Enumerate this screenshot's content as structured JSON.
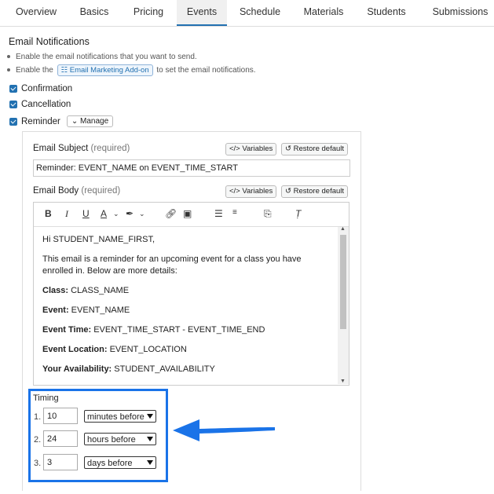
{
  "tabs": [
    "Overview",
    "Basics",
    "Pricing",
    "Events",
    "Schedule",
    "Materials",
    "Students",
    "Submissions"
  ],
  "active_tab": "Events",
  "section_title": "Email Notifications",
  "bullets": {
    "b1": "Enable the email notifications that you want to send.",
    "b2_prefix": "Enable the",
    "b2_button": "Email Marketing Add-on",
    "b2_suffix": "to set the email notifications."
  },
  "checkboxes": {
    "confirmation": "Confirmation",
    "cancellation": "Cancellation",
    "reminder": "Reminder",
    "manage": "Manage"
  },
  "subject": {
    "label": "Email Subject",
    "required": "(required)",
    "variables": "Variables",
    "restore": "Restore default",
    "value": "Reminder: EVENT_NAME on EVENT_TIME_START"
  },
  "body": {
    "label": "Email Body",
    "required": "(required)",
    "variables": "Variables",
    "restore": "Restore default",
    "greeting": "Hi STUDENT_NAME_FIRST,",
    "intro": "This email is a reminder for an upcoming event for a class you have enrolled in. Below are more details:",
    "class_label": "Class:",
    "class_value": " CLASS_NAME",
    "event_label": "Event:",
    "event_value": " EVENT_NAME",
    "time_label": "Event Time:",
    "time_value": " EVENT_TIME_START - EVENT_TIME_END",
    "location_label": "Event Location:",
    "location_value": " EVENT_LOCATION",
    "avail_label": "Your Availability:",
    "avail_value": " STUDENT_AVAILABILITY"
  },
  "timing": {
    "title": "Timing",
    "rows": [
      {
        "num": "1.",
        "value": "10",
        "unit": "minutes before"
      },
      {
        "num": "2.",
        "value": "24",
        "unit": "hours before"
      },
      {
        "num": "3.",
        "value": "3",
        "unit": "days before"
      }
    ]
  },
  "colors": {
    "accent": "#1a73e8",
    "link": "#2271b1"
  }
}
